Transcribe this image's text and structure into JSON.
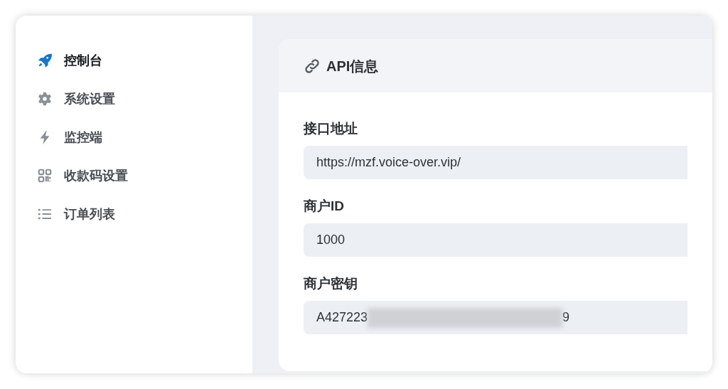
{
  "sidebar": {
    "items": [
      {
        "label": "控制台",
        "kind": "rocket",
        "selected": true
      },
      {
        "label": "系统设置",
        "kind": "gear",
        "selected": false
      },
      {
        "label": "监控端",
        "kind": "bolt",
        "selected": false
      },
      {
        "label": "收款码设置",
        "kind": "qr",
        "selected": false
      },
      {
        "label": "订单列表",
        "kind": "list",
        "selected": false
      }
    ]
  },
  "card": {
    "title": "API信息",
    "fields": [
      {
        "label": "接口地址",
        "value": "https://mzf.voice-over.vip/"
      },
      {
        "label": "商户ID",
        "value": "1000"
      },
      {
        "label": "商户密钥",
        "value": "A427223",
        "redacted": true,
        "value_end": "9"
      }
    ]
  }
}
